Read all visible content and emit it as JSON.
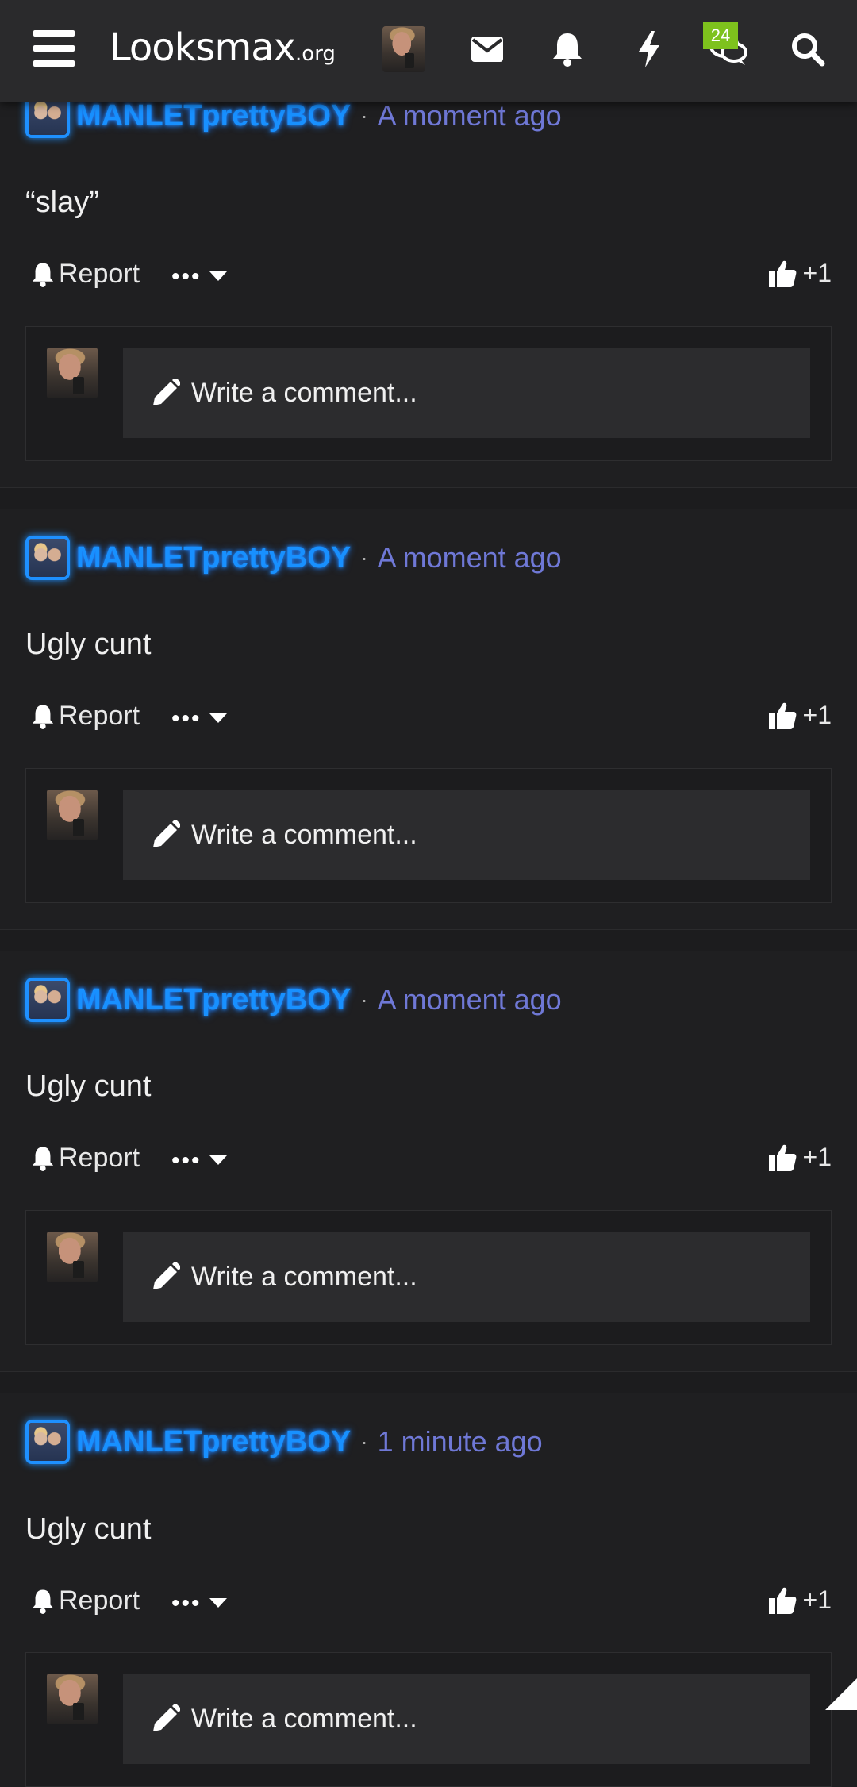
{
  "header": {
    "logo_main": "Lo oksmax",
    "logo_suffix": ".org",
    "conversations_badge": "24"
  },
  "posts": [
    {
      "username": "MANLETprettyBOY",
      "separator": "·",
      "time": "A moment ago",
      "text": "“slay”",
      "report": "Report",
      "more": "•••",
      "likes": "+1",
      "comment_placeholder": "Write a comment..."
    },
    {
      "username": "MANLETprettyBOY",
      "separator": "·",
      "time": "A moment ago",
      "text": "Ugly cunt",
      "report": "Report",
      "more": "•••",
      "likes": "+1",
      "comment_placeholder": "Write a comment..."
    },
    {
      "username": "MANLETprettyBOY",
      "separator": "·",
      "time": "A moment ago",
      "text": "Ugly cunt",
      "report": "Report",
      "more": "•••",
      "likes": "+1",
      "comment_placeholder": "Write a comment..."
    },
    {
      "username": "MANLETprettyBOY",
      "separator": "·",
      "time": "1 minute ago",
      "text": "Ugly cunt",
      "report": "Report",
      "more": "•••",
      "likes": "+1",
      "comment_placeholder": "Write a comment..."
    }
  ],
  "colors": {
    "username": "#1890ff",
    "time": "#6f78d6",
    "badge": "#7ec21d",
    "background": "#1f1f21"
  },
  "icons": [
    "menu-icon",
    "envelope-icon",
    "bell-icon",
    "bolt-icon",
    "chat-icon",
    "search-icon",
    "pencil-icon",
    "thumbs-up-icon",
    "caret-down-icon"
  ]
}
